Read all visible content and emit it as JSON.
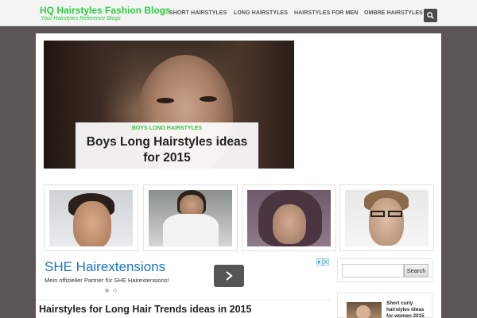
{
  "header": {
    "site_title": "HQ Hairstyles Fashion Blogs",
    "tagline": "Your Hairstyles Reference Blogs",
    "nav": [
      "SHORT HAIRSTYLES",
      "LONG HAIRSTYLES",
      "HAIRSTYLES FOR MEN",
      "OMBRE HAIRSTYLES"
    ],
    "search_icon": "search-icon"
  },
  "hero": {
    "category": "BOYS LONG HAIRSTYLES",
    "title_line1": "Boys Long Hairstyles ideas",
    "title_line2": "for 2015"
  },
  "ad": {
    "title": "SHE Hairextensions",
    "subtitle": "Mein offizieller Partner für SHE Hairextensions!",
    "arrow_icon": "chevron-right-icon",
    "choices_icon": "ad-choices-icon"
  },
  "article": {
    "title": "Hairstyles for Long Hair Trends ideas in 2015"
  },
  "sidebar": {
    "search_placeholder": "",
    "search_button": "Search",
    "post_title": "Short curly hairstyles ideas for women 2015"
  },
  "colors": {
    "brand_green": "#2ecc40",
    "background": "#5b5555",
    "ad_blue": "#1a73c8"
  }
}
